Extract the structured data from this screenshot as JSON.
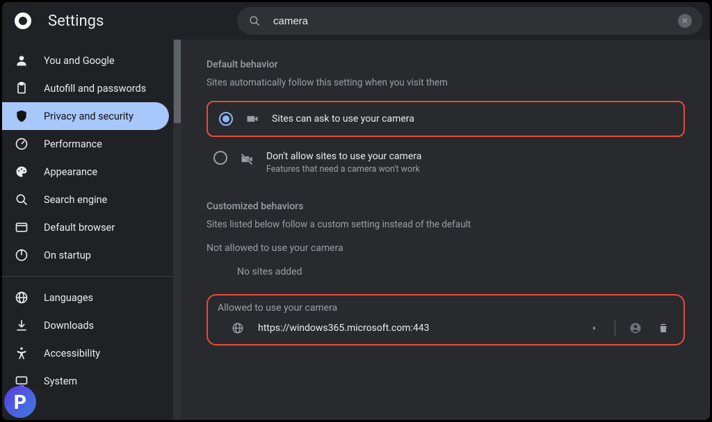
{
  "header": {
    "title": "Settings",
    "search_value": "camera"
  },
  "sidebar": {
    "items": [
      {
        "icon": "person",
        "label": "You and Google"
      },
      {
        "icon": "clipboard",
        "label": "Autofill and passwords"
      },
      {
        "icon": "shield",
        "label": "Privacy and security",
        "selected": true
      },
      {
        "icon": "gauge",
        "label": "Performance"
      },
      {
        "icon": "palette",
        "label": "Appearance"
      },
      {
        "icon": "search",
        "label": "Search engine"
      },
      {
        "icon": "browser",
        "label": "Default browser"
      },
      {
        "icon": "power",
        "label": "On startup"
      }
    ],
    "items2": [
      {
        "icon": "globe",
        "label": "Languages"
      },
      {
        "icon": "download",
        "label": "Downloads"
      },
      {
        "icon": "accessibility",
        "label": "Accessibility"
      },
      {
        "icon": "system",
        "label": "System"
      }
    ]
  },
  "main": {
    "default_behavior": {
      "title": "Default behavior",
      "desc": "Sites automatically follow this setting when you visit them",
      "option_allow": {
        "label": "Sites can ask to use your camera"
      },
      "option_block": {
        "label": "Don't allow sites to use your camera",
        "sub": "Features that need a camera won't work"
      }
    },
    "custom": {
      "title": "Customized behaviors",
      "desc": "Sites listed below follow a custom setting instead of the default",
      "blocked_title": "Not allowed to use your camera",
      "blocked_empty": "No sites added",
      "allowed_title": "Allowed to use your camera",
      "allowed_sites": [
        {
          "url": "https://windows365.microsoft.com:443"
        }
      ]
    }
  }
}
